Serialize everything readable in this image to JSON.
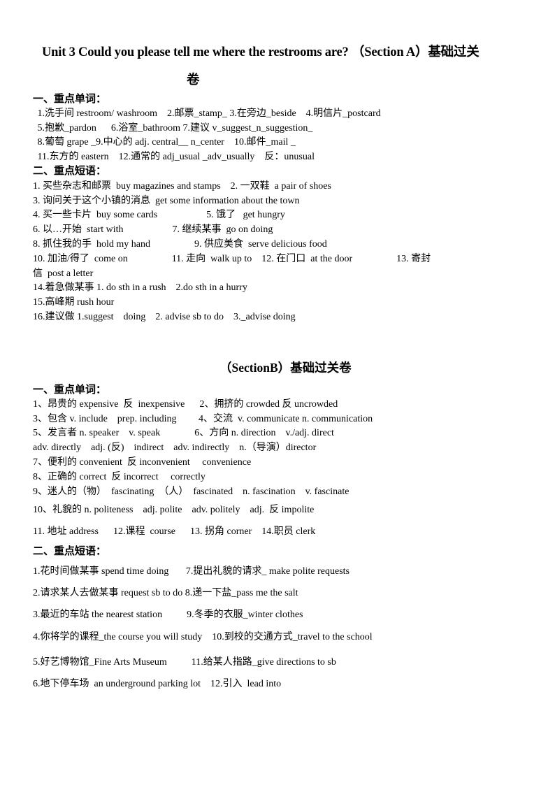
{
  "title": {
    "line1": "Unit 3 Could you please tell me where the restrooms are? （Section A）基础过关",
    "line2": "卷"
  },
  "sectionA": {
    "words_heading": "一、重点单词：",
    "words": [
      " 1.洗手间 restroom/ washroom    2.邮票_stamp_ 3.在旁边_beside    4.明信片_postcard",
      " 5.抱歉_pardon      6.浴室_bathroom 7.建议 v_suggest_n_suggestion_",
      " 8.葡萄 grape _9.中心的 adj. central__ n_center    10.邮件_mail _",
      " 11.东方的 eastern    12.通常的 adj_usual _adv_usually    反：unusual"
    ],
    "phrases_heading": "二、重点短语：",
    "phrases": [
      "1. 买些杂志和邮票  buy magazines and stamps    2. 一双鞋  a pair of shoes",
      "3. 询问关于这个小镇的消息  get some information about the town",
      "4. 买一些卡片  buy some cards                    5. 饿了   get hungry",
      "6. 以…开始  start with                    7. 继续某事  go on doing",
      "8. 抓住我的手  hold my hand                  9. 供应美食  serve delicious food",
      "10. 加油/得了  come on                  11. 走向  walk up to    12. 在门口  at the door                  13. 寄封",
      "信  post a letter",
      "14.着急做某事 1. do sth in a rush    2.do sth in a hurry",
      "15.高峰期 rush hour",
      "16.建议做 1.suggest    doing    2. advise sb to do    3._advise doing"
    ]
  },
  "sectionB": {
    "heading": "（SectionB）基础过关卷",
    "words_heading": "一、重点单词：",
    "words": [
      "1、昂贵的 expensive  反  inexpensive      2、拥挤的 crowded 反 uncrowded",
      "3、包含 v. include    prep. including         4、交流  v. communicate n. communication",
      "5、发言者 n. speaker    v. speak              6、方向 n. direction    v./adj. direct",
      "adv. directly    adj. (反)    indirect    adv. indirectly    n.（导演）director",
      "7、便利的 convenient  反 inconvenient     convenience",
      "8、正确的 correct  反 incorrect     correctly",
      "9、迷人的（物）  fascinating  （人）  fascinated    n. fascination    v. fascinate",
      "10、礼貌的 n. politeness    adj. polite    adv. politely    adj.  反 impolite",
      "11. 地址 address      12.课程  course      13. 拐角 corner    14.职员 clerk"
    ],
    "phrases_heading": "二、重点短语：",
    "phrases": [
      "1.花时间做某事 spend time doing       7.提出礼貌的请求_ make polite requests",
      "2.请求某人去做某事 request sb to do 8.递一下盐_pass me the salt",
      "3.最近的车站 the nearest station          9.冬季的衣服_winter clothes",
      "4.你将学的课程_the course you will study    10.到校的交通方式_travel to the school",
      "5.好艺博物馆_Fine Arts Museum          11.给某人指路_give directions to sb",
      "6.地下停车场  an underground parking lot    12.引入  lead into"
    ]
  }
}
